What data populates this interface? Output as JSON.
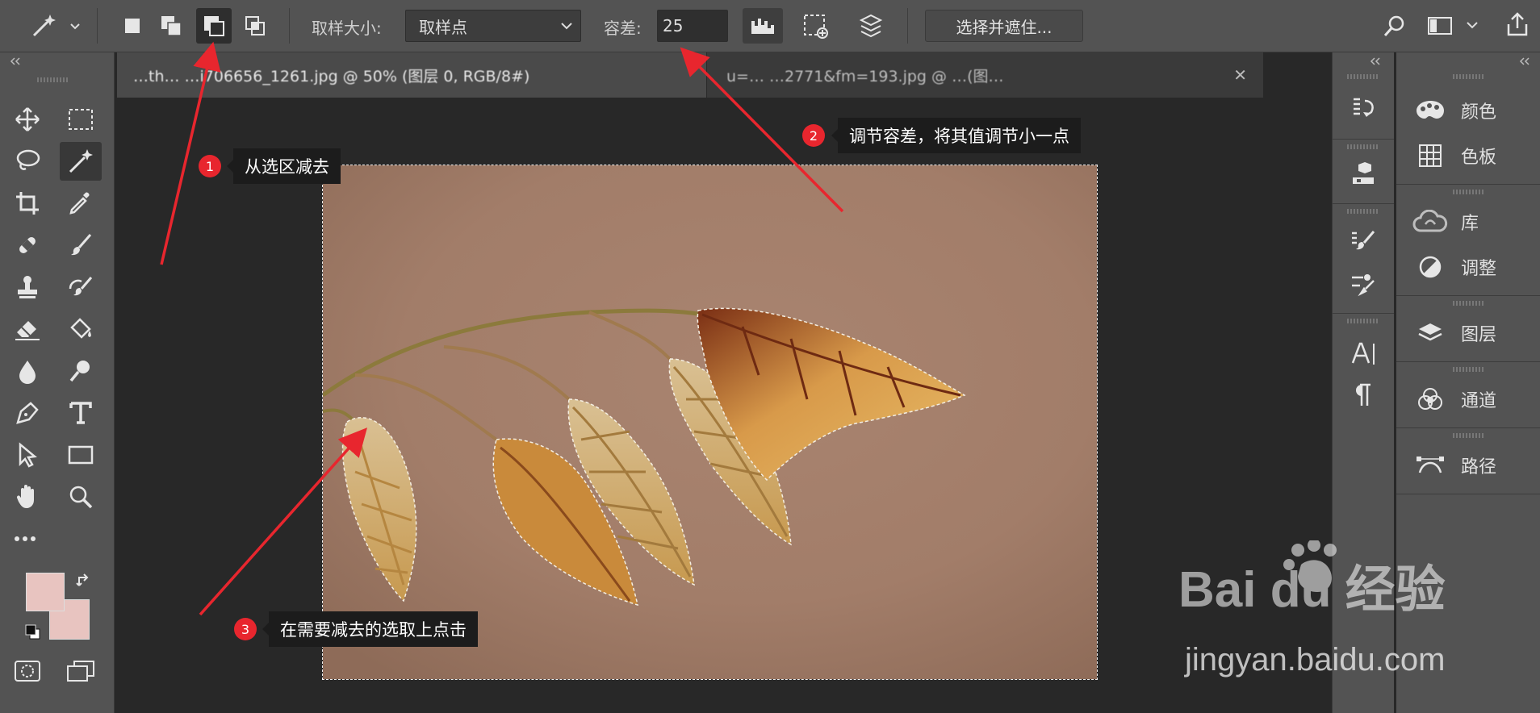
{
  "options_bar": {
    "sample_size_label": "取样大小:",
    "sample_size_value": "取样点",
    "tolerance_label": "容差:",
    "tolerance_value": "25",
    "select_mask_button": "选择并遮住..."
  },
  "tabs": [
    {
      "label": "…th…   …i706656_1261.jpg @ 50% (图层 0, RGB/8#)",
      "active": true
    },
    {
      "label": "u=…        …2771&fm=193.jpg @ …(图…",
      "active": false
    }
  ],
  "panels": [
    {
      "label": "颜色",
      "icon": "palette-icon"
    },
    {
      "label": "色板",
      "icon": "swatches-grid-icon"
    },
    {
      "label": "库",
      "icon": "libraries-cloud-icon"
    },
    {
      "label": "调整",
      "icon": "adjustments-icon"
    },
    {
      "label": "图层",
      "icon": "layers-icon"
    },
    {
      "label": "通道",
      "icon": "channels-icon"
    },
    {
      "label": "路径",
      "icon": "paths-icon"
    }
  ],
  "annotations": [
    {
      "num": "1",
      "text": "从选区减去"
    },
    {
      "num": "2",
      "text": "调节容差，将其值调节小一点"
    },
    {
      "num": "3",
      "text": "在需要减去的选取上点击"
    }
  ],
  "watermark": {
    "brand": "Bai du 经验",
    "url": "jingyan.baidu.com"
  },
  "colors": {
    "foreground": "#e8c4c0",
    "background": "#e8c4c0",
    "annotation_red": "#e8262e",
    "image_bg": "#a47f6a"
  }
}
